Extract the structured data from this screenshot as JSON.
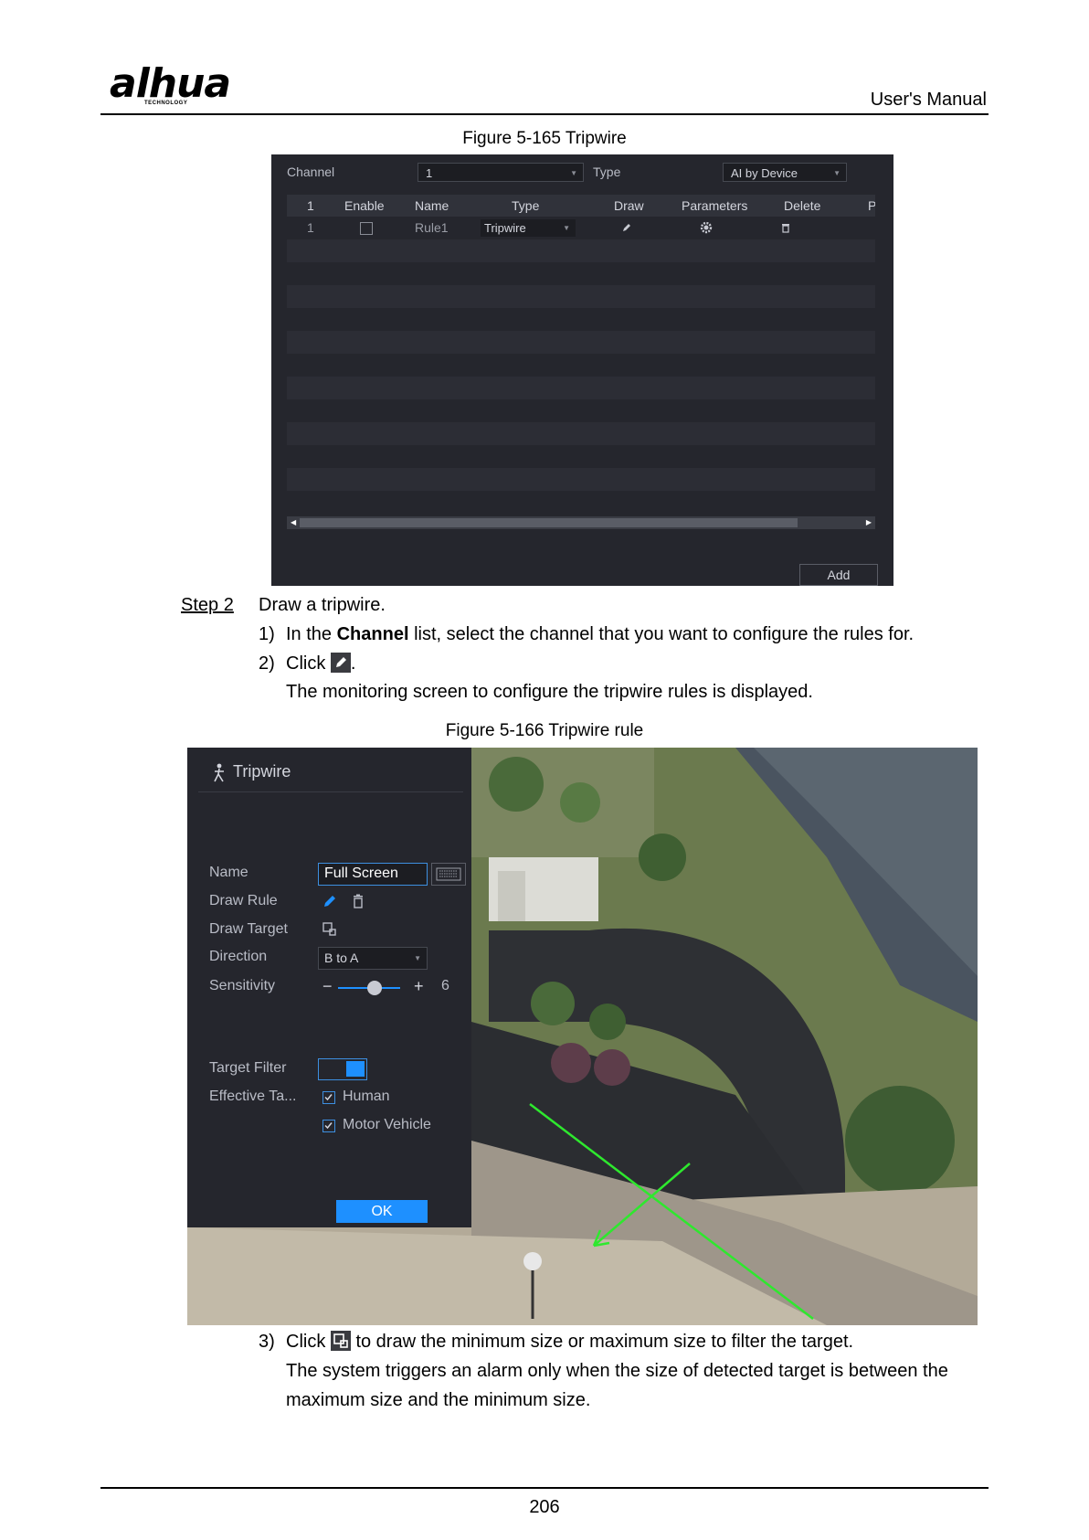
{
  "header": {
    "logo_text": "alhua",
    "logo_sub": "TECHNOLOGY",
    "manual_title": "User's Manual"
  },
  "figure165": {
    "caption": "Figure 5-165 Tripwire",
    "channel_label": "Channel",
    "channel_value": "1",
    "type_label": "Type",
    "type_value": "AI by Device",
    "table_headers": [
      "1",
      "Enable",
      "Name",
      "Type",
      "Draw",
      "Parameters",
      "Delete",
      "P"
    ],
    "row": {
      "index": "1",
      "name": "Rule1",
      "type": "Tripwire"
    },
    "add_button": "Add"
  },
  "step2": {
    "step_label": "Step 2",
    "title": "Draw a tripwire.",
    "item1_num": "1)",
    "item1_pre": "In the ",
    "item1_bold": "Channel",
    "item1_post": " list, select the channel that you want to configure the rules for.",
    "item2_num": "2)",
    "item2_pre": "Click ",
    "item2_post": ".",
    "item2_desc": "The monitoring screen to configure the tripwire rules is displayed."
  },
  "figure166": {
    "caption": "Figure 5-166 Tripwire rule",
    "panel_title": "Tripwire",
    "name_label": "Name",
    "name_value": "Full Screen",
    "draw_rule_label": "Draw Rule",
    "draw_target_label": "Draw Target",
    "direction_label": "Direction",
    "direction_value": "B to A",
    "sensitivity_label": "Sensitivity",
    "sensitivity_value": "6",
    "target_filter_label": "Target Filter",
    "effective_target_label": "Effective Ta...",
    "target_human": "Human",
    "target_motor": "Motor Vehicle",
    "ok_button": "OK"
  },
  "step3": {
    "item3_num": "3)",
    "item3_pre": "Click ",
    "item3_post": " to draw the minimum size or maximum size to filter the target.",
    "line2": "The system triggers an alarm only when the size of detected target is between the",
    "line3": "maximum size and the minimum size."
  },
  "footer": {
    "page_number": "206"
  }
}
